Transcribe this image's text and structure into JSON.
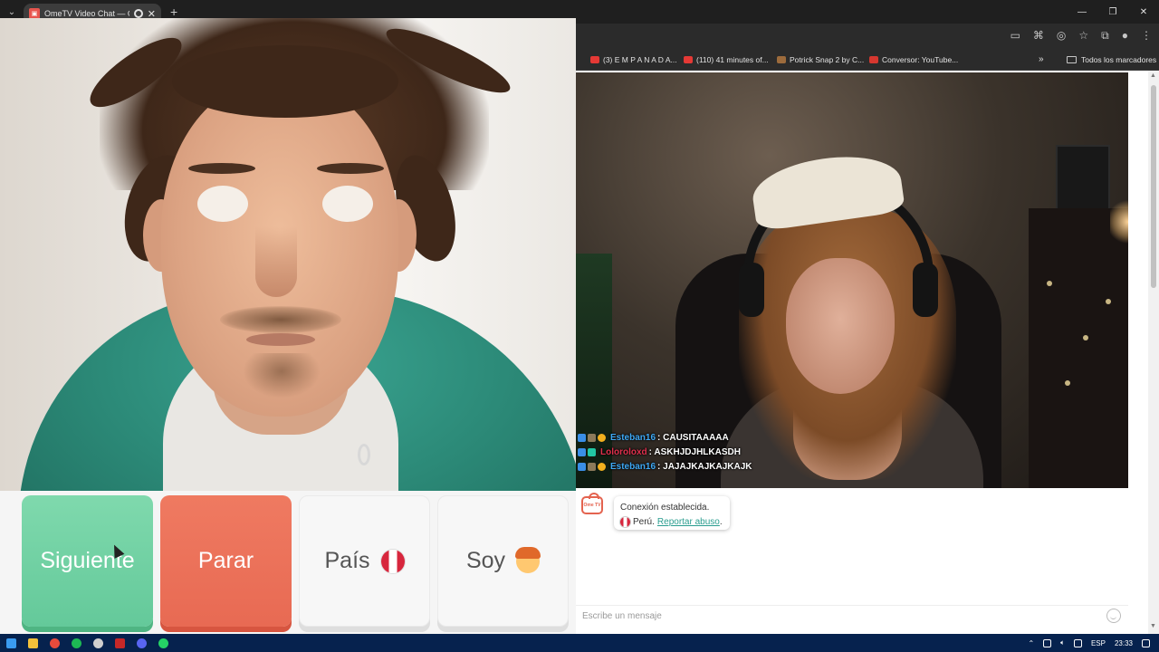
{
  "browser": {
    "tab_title": "OmeTV Video Chat — Ome",
    "new_tab_symbol": "+",
    "close_symbol": "✕",
    "window_controls": [
      "—",
      "❐",
      "✕"
    ],
    "bookmarks": [
      {
        "label": "(3) E M P A N A D A...",
        "color": "#e53935"
      },
      {
        "label": "(110) 41 minutes of...",
        "color": "#e53935"
      },
      {
        "label": "Potrick Snap 2 by C...",
        "color": "#9c6b3c"
      },
      {
        "label": "Conversor: YouTube...",
        "color": "#d6372f"
      }
    ],
    "bookmarks_more": "»",
    "all_bookmarks": "Todos los marcadores"
  },
  "controls": {
    "next": "Siguiente",
    "stop": "Parar",
    "country": "País",
    "me": "Soy"
  },
  "overlay_chat": [
    {
      "name": "Esteban16",
      "name_color": "#3fa9f5",
      "text": ": CAUSITAAAAA"
    },
    {
      "name": "Loloroloxd",
      "name_color": "#e0304d",
      "text": ": ASKHJDJHLKASDH"
    },
    {
      "name": "Esteban16",
      "name_color": "#3fa9f5",
      "text": ": JAJAJKAJKAJKAJK"
    }
  ],
  "chat": {
    "logo_text": "Ome TV",
    "connection": "Conexión establecida.",
    "country": "Perú.",
    "report": "Reportar abuso",
    "report_suffix": ".",
    "input_placeholder": "Escribe un mensaje"
  },
  "taskbar": {
    "icons": [
      {
        "name": "windows-start-icon",
        "color": "#3a9bf0"
      },
      {
        "name": "file-explorer-icon",
        "color": "#f3c13a"
      },
      {
        "name": "chrome-icon",
        "color": "#e84b3c"
      },
      {
        "name": "spotify-icon",
        "color": "#1db954"
      },
      {
        "name": "obs-icon",
        "color": "#cfcfcf"
      },
      {
        "name": "news-icon",
        "color": "#c62828"
      },
      {
        "name": "discord-icon",
        "color": "#5865f2"
      },
      {
        "name": "whatsapp-icon",
        "color": "#25d366"
      }
    ],
    "language": "ESP",
    "time": "23:33"
  }
}
